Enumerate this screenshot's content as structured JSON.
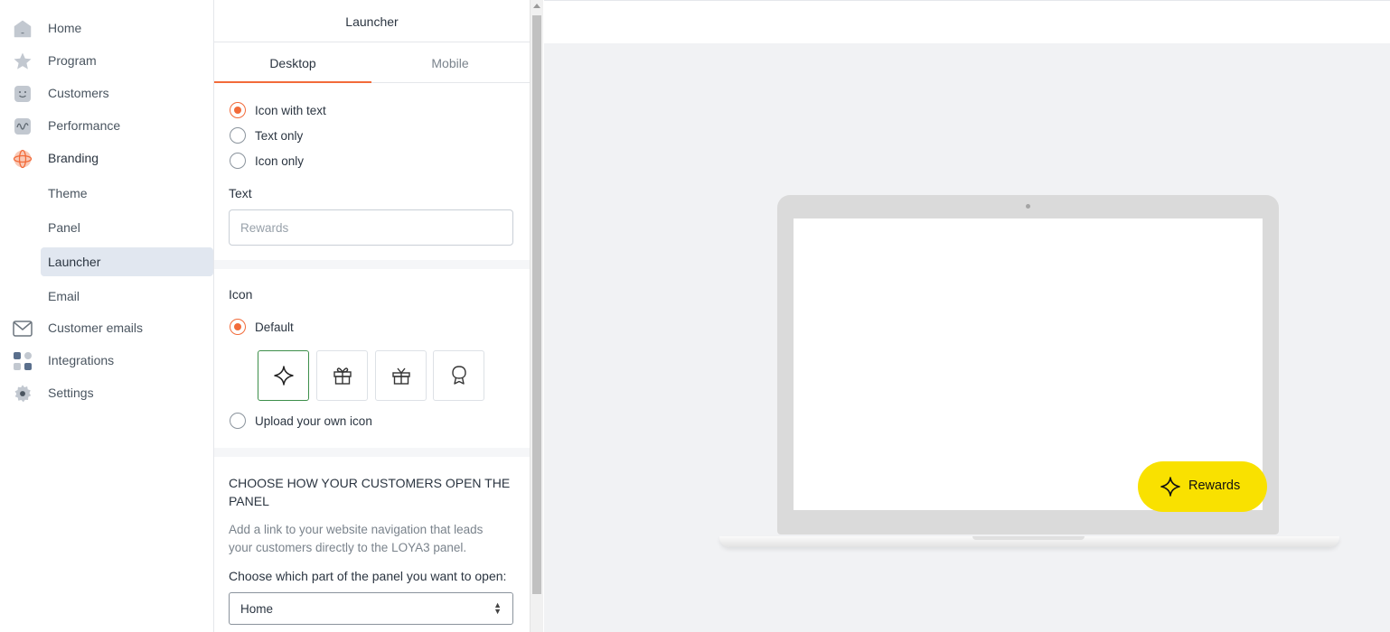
{
  "sidebar": {
    "items": [
      {
        "label": "Home",
        "icon": "home-icon"
      },
      {
        "label": "Program",
        "icon": "star-icon"
      },
      {
        "label": "Customers",
        "icon": "smiley-icon"
      },
      {
        "label": "Performance",
        "icon": "wave-icon"
      },
      {
        "label": "Branding",
        "icon": "globe-icon"
      }
    ],
    "sub_items": [
      {
        "label": "Theme"
      },
      {
        "label": "Panel"
      },
      {
        "label": "Launcher",
        "active": true
      },
      {
        "label": "Email"
      }
    ],
    "bottom_items": [
      {
        "label": "Customer emails",
        "icon": "envelope-icon"
      },
      {
        "label": "Integrations",
        "icon": "grid-icon"
      },
      {
        "label": "Settings",
        "icon": "gear-icon"
      }
    ]
  },
  "editor": {
    "title": "Launcher",
    "tabs": [
      {
        "label": "Desktop",
        "active": true
      },
      {
        "label": "Mobile",
        "active": false
      }
    ],
    "display_options": [
      {
        "label": "Icon with text",
        "checked": true
      },
      {
        "label": "Text only",
        "checked": false
      },
      {
        "label": "Icon only",
        "checked": false
      }
    ],
    "text_field": {
      "label": "Text",
      "value": "",
      "placeholder": "Rewards"
    },
    "icon_section": {
      "label": "Icon",
      "default_label": "Default",
      "default_checked": true,
      "choices": [
        "sparkle-icon",
        "gift-box-icon",
        "gift-icon",
        "badge-icon"
      ],
      "selected_index": 0,
      "upload_label": "Upload your own icon",
      "upload_checked": false
    },
    "open_panel": {
      "heading": "CHOOSE HOW YOUR CUSTOMERS OPEN THE PANEL",
      "description": "Add a link to your website navigation that leads your customers directly to the LOYA3 panel.",
      "choose_label": "Choose which part of the panel you want to open:",
      "select_value": "Home"
    }
  },
  "preview": {
    "launcher_label": "Rewards",
    "launcher_icon": "sparkle-icon",
    "launcher_color": "#f9e100"
  },
  "colors": {
    "accent": "#f26b3a",
    "selected_border": "#3d8f4a",
    "active_nav_bg": "#e1e7f0"
  }
}
